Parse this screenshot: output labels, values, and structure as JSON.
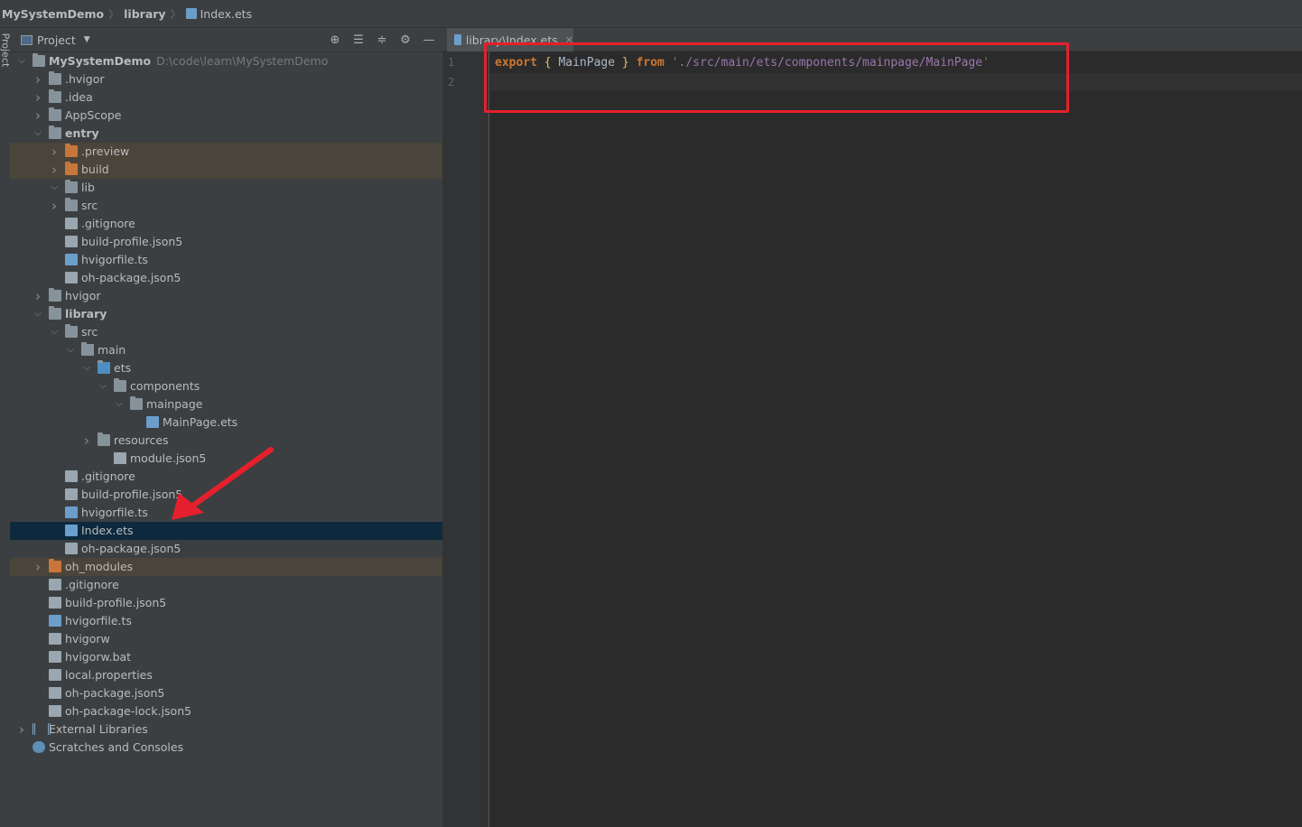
{
  "breadcrumb": {
    "project": "MySystemDemo",
    "folder": "library",
    "file": "Index.ets"
  },
  "tool_strip": {
    "label": "Project"
  },
  "project_panel": {
    "title": "Project",
    "tools": [
      "locate-icon",
      "expand-all-icon",
      "collapse-all-icon",
      "gear-icon",
      "hide-icon"
    ]
  },
  "tree": [
    {
      "label": "MySystemDemo",
      "extra": "D:\\code\\learn\\MySystemDemo",
      "depth": 0,
      "expand": "open",
      "icon": "module",
      "bold": true
    },
    {
      "label": ".hvigor",
      "depth": 1,
      "expand": "closed",
      "icon": "folder"
    },
    {
      "label": ".idea",
      "depth": 1,
      "expand": "closed",
      "icon": "folder"
    },
    {
      "label": "AppScope",
      "depth": 1,
      "expand": "closed",
      "icon": "folder"
    },
    {
      "label": "entry",
      "depth": 1,
      "expand": "open",
      "icon": "module",
      "bold": true
    },
    {
      "label": ".preview",
      "depth": 2,
      "expand": "closed",
      "icon": "folder-orange",
      "excluded": true
    },
    {
      "label": "build",
      "depth": 2,
      "expand": "closed",
      "icon": "folder-orange",
      "excluded": true
    },
    {
      "label": "lib",
      "depth": 2,
      "expand": "open",
      "icon": "folder"
    },
    {
      "label": "src",
      "depth": 2,
      "expand": "closed",
      "icon": "folder"
    },
    {
      "label": ".gitignore",
      "depth": 2,
      "expand": "none",
      "icon": "file"
    },
    {
      "label": "build-profile.json5",
      "depth": 2,
      "expand": "none",
      "icon": "file"
    },
    {
      "label": "hvigorfile.ts",
      "depth": 2,
      "expand": "none",
      "icon": "ts-file"
    },
    {
      "label": "oh-package.json5",
      "depth": 2,
      "expand": "none",
      "icon": "file"
    },
    {
      "label": "hvigor",
      "depth": 1,
      "expand": "closed",
      "icon": "folder"
    },
    {
      "label": "library",
      "depth": 1,
      "expand": "open",
      "icon": "module",
      "bold": true
    },
    {
      "label": "src",
      "depth": 2,
      "expand": "open",
      "icon": "folder"
    },
    {
      "label": "main",
      "depth": 3,
      "expand": "open",
      "icon": "folder"
    },
    {
      "label": "ets",
      "depth": 4,
      "expand": "open",
      "icon": "folder-blue"
    },
    {
      "label": "components",
      "depth": 5,
      "expand": "open",
      "icon": "folder"
    },
    {
      "label": "mainpage",
      "depth": 6,
      "expand": "open",
      "icon": "folder"
    },
    {
      "label": "MainPage.ets",
      "depth": 7,
      "expand": "none",
      "icon": "ets-file"
    },
    {
      "label": "resources",
      "depth": 4,
      "expand": "closed",
      "icon": "folder"
    },
    {
      "label": "module.json5",
      "depth": 5,
      "expand": "none",
      "icon": "file"
    },
    {
      "label": ".gitignore",
      "depth": 2,
      "expand": "none",
      "icon": "file"
    },
    {
      "label": "build-profile.json5",
      "depth": 2,
      "expand": "none",
      "icon": "file"
    },
    {
      "label": "hvigorfile.ts",
      "depth": 2,
      "expand": "none",
      "icon": "ts-file"
    },
    {
      "label": "Index.ets",
      "depth": 2,
      "expand": "none",
      "icon": "ets-file",
      "selected": true
    },
    {
      "label": "oh-package.json5",
      "depth": 2,
      "expand": "none",
      "icon": "file"
    },
    {
      "label": "oh_modules",
      "depth": 1,
      "expand": "closed",
      "icon": "folder-orange",
      "excluded": true
    },
    {
      "label": ".gitignore",
      "depth": 1,
      "expand": "none",
      "icon": "file"
    },
    {
      "label": "build-profile.json5",
      "depth": 1,
      "expand": "none",
      "icon": "file"
    },
    {
      "label": "hvigorfile.ts",
      "depth": 1,
      "expand": "none",
      "icon": "ts-file"
    },
    {
      "label": "hvigorw",
      "depth": 1,
      "expand": "none",
      "icon": "exec-file"
    },
    {
      "label": "hvigorw.bat",
      "depth": 1,
      "expand": "none",
      "icon": "file"
    },
    {
      "label": "local.properties",
      "depth": 1,
      "expand": "none",
      "icon": "props-file"
    },
    {
      "label": "oh-package.json5",
      "depth": 1,
      "expand": "none",
      "icon": "file"
    },
    {
      "label": "oh-package-lock.json5",
      "depth": 1,
      "expand": "none",
      "icon": "file"
    },
    {
      "label": "External Libraries",
      "depth": 0,
      "expand": "closed",
      "icon": "libraries"
    },
    {
      "label": "Scratches and Consoles",
      "depth": 0,
      "expand": "none",
      "icon": "scratches"
    }
  ],
  "editor": {
    "tab_label": "library\\Index.ets",
    "line_numbers": [
      "1",
      "2"
    ],
    "code": {
      "kw_export": "export",
      "brace_open": "{",
      "identifier": "MainPage",
      "brace_close": "}",
      "kw_from": "from",
      "quote_open": "'",
      "path": "./src/main/ets/components/mainpage/MainPage",
      "quote_close": "'"
    }
  },
  "colors": {
    "highlight_box": "#e5202c",
    "annotation_arrow": "#e5202c",
    "selected_row": "#0d293e",
    "excluded_row": "#4a443a"
  }
}
